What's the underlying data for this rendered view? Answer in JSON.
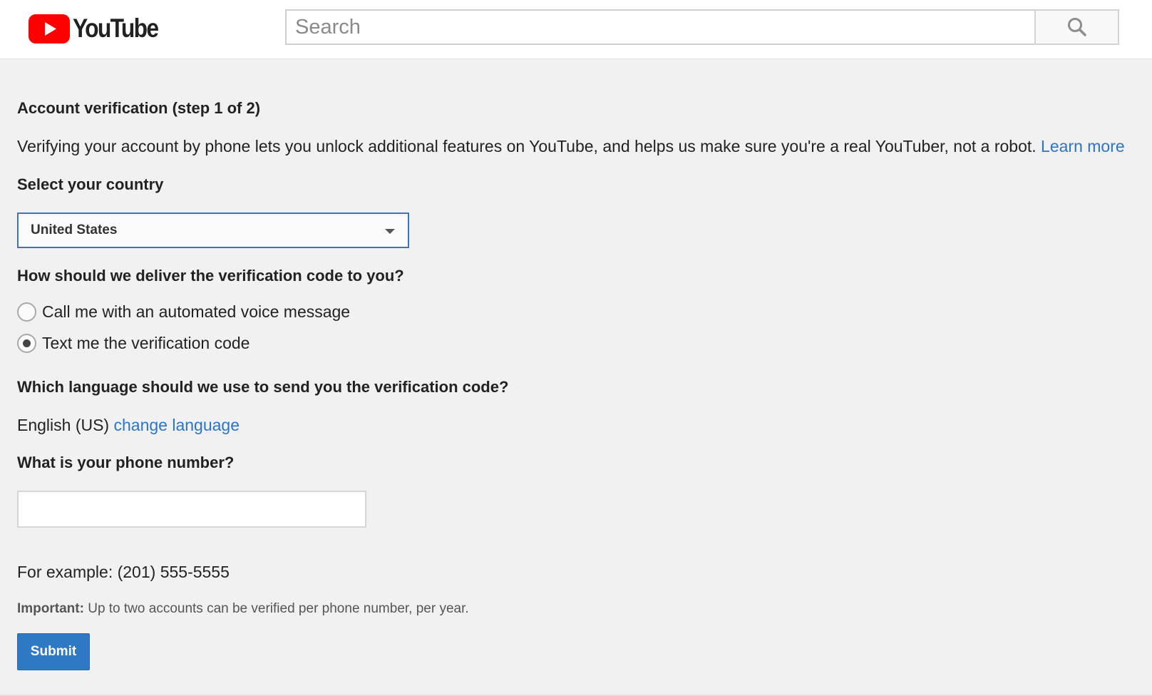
{
  "header": {
    "logo_text": "YouTube",
    "search_placeholder": "Search",
    "search_value": ""
  },
  "form": {
    "title": "Account verification (step 1 of 2)",
    "description": "Verifying your account by phone lets you unlock additional features on YouTube, and helps us make sure you're a real YouTuber, not a robot.",
    "learn_more": "Learn more",
    "country_label": "Select your country",
    "country_value": "United States",
    "delivery_label": "How should we deliver the verification code to you?",
    "delivery_options": [
      {
        "label": "Call me with an automated voice message",
        "selected": false
      },
      {
        "label": "Text me the verification code",
        "selected": true
      }
    ],
    "language_label": "Which language should we use to send you the verification code?",
    "language_value": "English (US)",
    "change_language": "change language",
    "phone_label": "What is your phone number?",
    "phone_value": "",
    "example": "For example: (201) 555-5555",
    "important_label": "Important:",
    "important_text": " Up to two accounts can be verified per phone number, per year.",
    "submit_label": "Submit"
  },
  "colors": {
    "brand_red": "#ff0000",
    "link_blue": "#2e74c4",
    "button_blue": "#2f78c4",
    "page_bg": "#f1f1f1"
  },
  "icons": {
    "logo": "youtube-play-icon",
    "search": "search-icon",
    "dropdown": "chevron-down-icon"
  }
}
